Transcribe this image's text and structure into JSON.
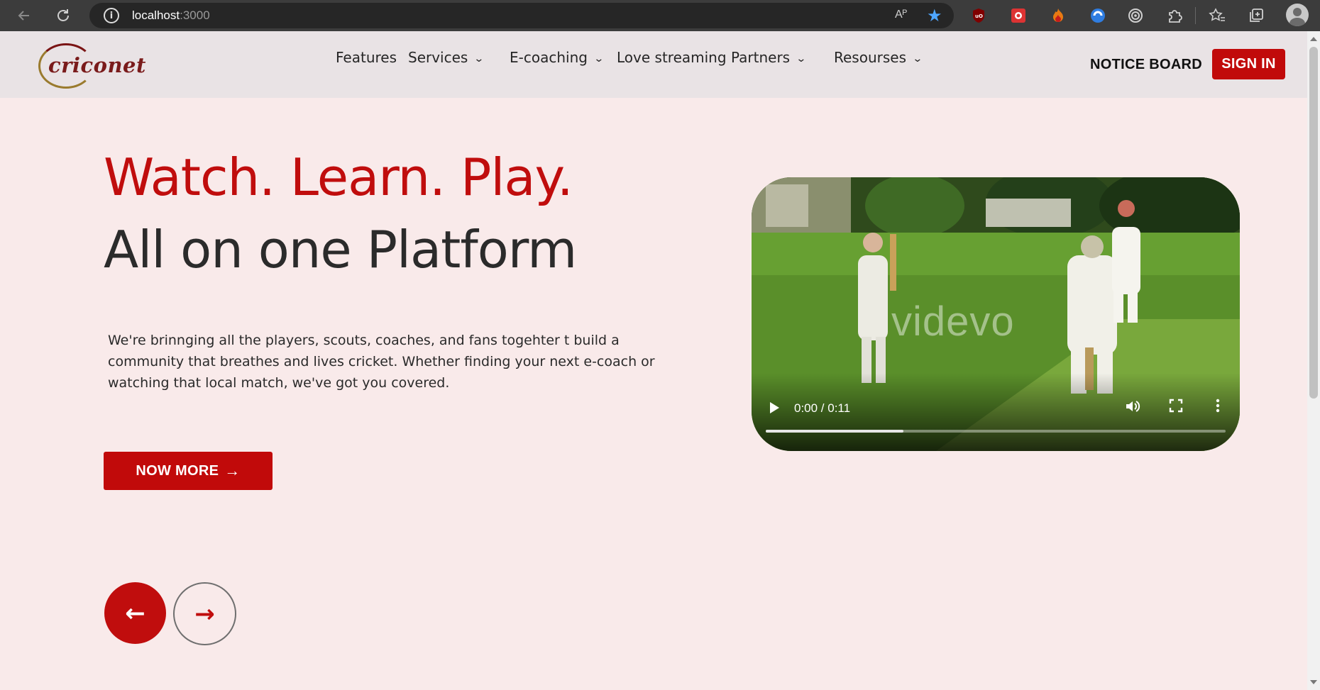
{
  "browser": {
    "url_host": "localhost",
    "url_port": ":3000",
    "read_aloud_label": "Aᴾ",
    "extensions": [
      "uBlock",
      "ext-red",
      "ext-flame",
      "ext-blue",
      "ext-circle",
      "extensions-icon",
      "favorites-icon",
      "collections-icon"
    ]
  },
  "header": {
    "logo_text": "criconet",
    "nav": [
      {
        "label": "Features",
        "dropdown": false
      },
      {
        "label": "Services",
        "dropdown": true
      },
      {
        "label": "E-coaching",
        "dropdown": true
      },
      {
        "label": "Love streaming",
        "dropdown": false
      },
      {
        "label": "Partners",
        "dropdown": true
      },
      {
        "label": "Resourses",
        "dropdown": true
      }
    ],
    "notice_board": "NOTICE BOARD",
    "sign_in": "SIGN IN"
  },
  "hero": {
    "headline_1": "Watch. Learn. Play.",
    "headline_2": "All on one Platform",
    "intro": "We're brinnging all the players, scouts, coaches, and fans togehter t build a community that breathes and lives cricket. Whether finding your next e-coach or watching that local match, we've got you covered.",
    "cta_label": "NOW MORE",
    "cta_arrow": "→",
    "prev_arrow": "←",
    "next_arrow": "→"
  },
  "video": {
    "time_display": "0:00 / 0:11",
    "progress_fraction": 0.3,
    "watermark": "videvo"
  },
  "colors": {
    "brand_red": "#c10a0a",
    "page_bg": "#f9eaea",
    "header_bg": "#e9e3e5"
  }
}
